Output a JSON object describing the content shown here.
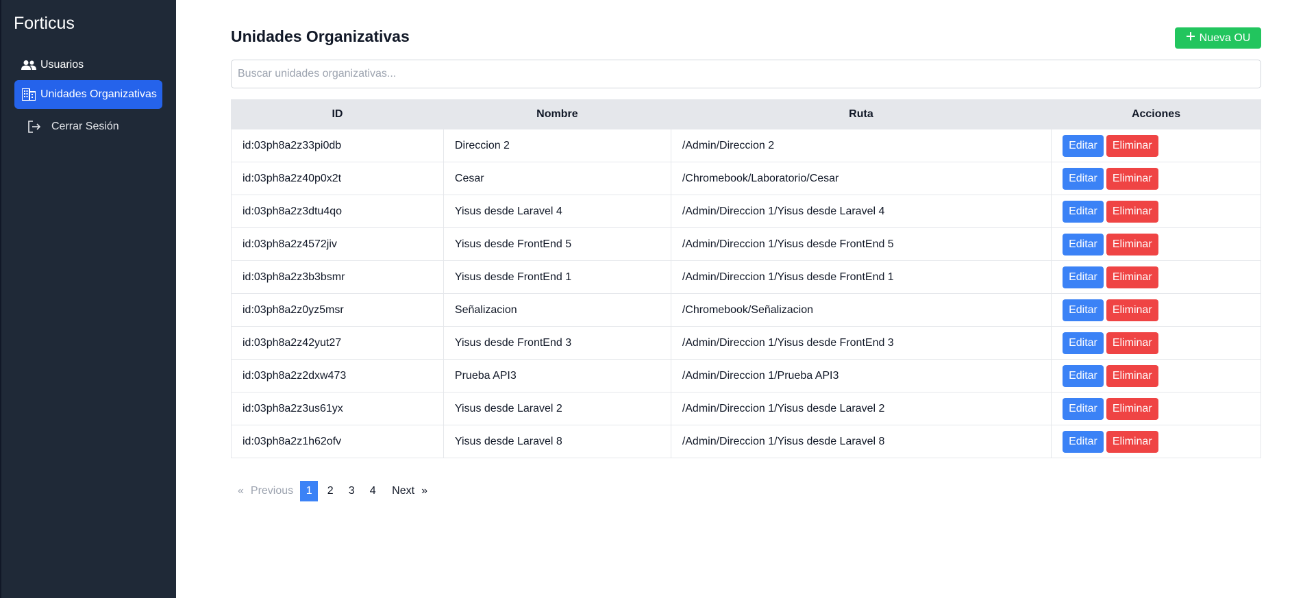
{
  "sidebar": {
    "brand": "Forticus",
    "items": [
      {
        "label": "Usuarios",
        "icon": "users-icon"
      },
      {
        "label": "Unidades Organizativas",
        "icon": "building-icon",
        "active": true
      },
      {
        "label": "Cerrar Sesión",
        "icon": "logout-icon"
      }
    ]
  },
  "main": {
    "title": "Unidades Organizativas",
    "new_button": "Nueva OU",
    "search_placeholder": "Buscar unidades organizativas...",
    "table": {
      "headers": [
        "ID",
        "Nombre",
        "Ruta",
        "Acciones"
      ],
      "rows": [
        {
          "id": "id:03ph8a2z33pi0db",
          "name": "Direccion 2",
          "path": "/Admin/Direccion 2"
        },
        {
          "id": "id:03ph8a2z40p0x2t",
          "name": "Cesar",
          "path": "/Chromebook/Laboratorio/Cesar"
        },
        {
          "id": "id:03ph8a2z3dtu4qo",
          "name": "Yisus desde Laravel 4",
          "path": "/Admin/Direccion 1/Yisus desde Laravel 4"
        },
        {
          "id": "id:03ph8a2z4572jiv",
          "name": "Yisus desde FrontEnd 5",
          "path": "/Admin/Direccion 1/Yisus desde FrontEnd 5"
        },
        {
          "id": "id:03ph8a2z3b3bsmr",
          "name": "Yisus desde FrontEnd 1",
          "path": "/Admin/Direccion 1/Yisus desde FrontEnd 1"
        },
        {
          "id": "id:03ph8a2z0yz5msr",
          "name": "Señalizacion",
          "path": "/Chromebook/Señalizacion"
        },
        {
          "id": "id:03ph8a2z42yut27",
          "name": "Yisus desde FrontEnd 3",
          "path": "/Admin/Direccion 1/Yisus desde FrontEnd 3"
        },
        {
          "id": "id:03ph8a2z2dxw473",
          "name": "Prueba API3",
          "path": "/Admin/Direccion 1/Prueba API3"
        },
        {
          "id": "id:03ph8a2z3us61yx",
          "name": "Yisus desde Laravel 2",
          "path": "/Admin/Direccion 1/Yisus desde Laravel 2"
        },
        {
          "id": "id:03ph8a2z1h62ofv",
          "name": "Yisus desde Laravel 8",
          "path": "/Admin/Direccion 1/Yisus desde Laravel 8"
        }
      ],
      "edit_label": "Editar",
      "delete_label": "Eliminar"
    },
    "pagination": {
      "prev_arrow": "«",
      "prev": "Previous",
      "pages": [
        "1",
        "2",
        "3",
        "4"
      ],
      "current": "1",
      "next": "Next",
      "next_arrow": "»"
    }
  },
  "colors": {
    "sidebar_bg": "#1f2937",
    "active_nav": "#2563eb",
    "new_button": "#22c55e",
    "edit_button": "#3b82f6",
    "delete_button": "#ef4444",
    "header_bg": "#e5e7eb"
  }
}
